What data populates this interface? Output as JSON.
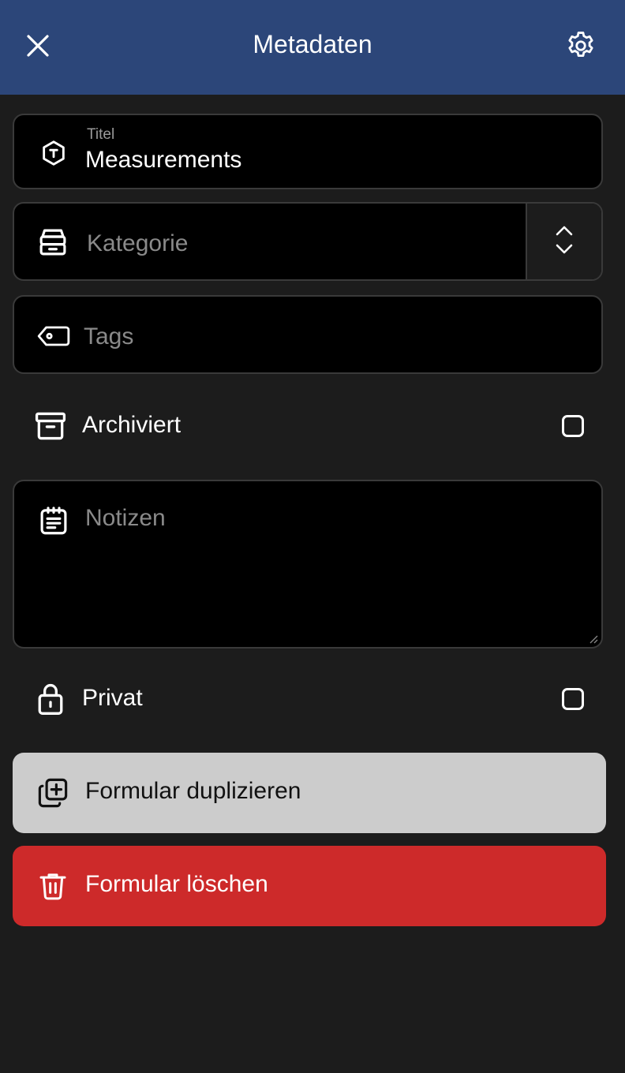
{
  "header": {
    "title": "Metadaten",
    "close_icon": "close-icon",
    "settings_icon": "gear-icon",
    "background": "#2c4679"
  },
  "fields": {
    "title": {
      "label": "Titel",
      "value": "Measurements",
      "icon": "title-hexagon-icon"
    },
    "category": {
      "placeholder": "Kategorie",
      "icon": "stack-icon",
      "arrow_icon": "chevron-up-down-icon"
    },
    "tags": {
      "placeholder": "Tags",
      "icon": "tag-icon"
    },
    "archived": {
      "label": "Archiviert",
      "checked": false,
      "icon": "archive-icon"
    },
    "notes": {
      "placeholder": "Notizen",
      "icon": "notes-icon"
    },
    "private": {
      "label": "Privat",
      "checked": false,
      "icon": "lock-icon"
    }
  },
  "actions": {
    "duplicate": {
      "label": "Formular duplizieren",
      "icon": "duplicate-icon",
      "color": "#cccccc"
    },
    "delete": {
      "label": "Formular löschen",
      "icon": "trash-icon",
      "color": "#cd2a2a"
    }
  }
}
